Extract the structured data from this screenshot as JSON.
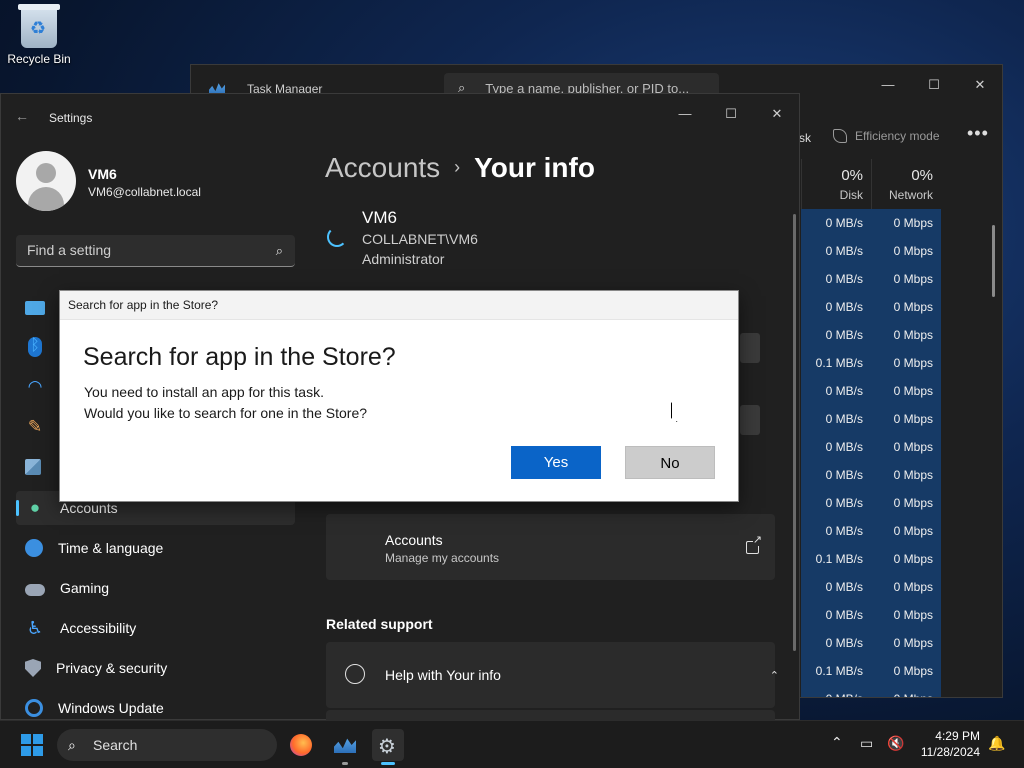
{
  "desktop": {
    "recycle_bin_label": "Recycle Bin"
  },
  "task_manager": {
    "title": "Task Manager",
    "search_placeholder": "Type a name, publisher, or PID to...",
    "toolbar_fragment": "sk",
    "efficiency_mode": "Efficiency mode",
    "more": "•••",
    "columns": [
      {
        "percent": "0%",
        "name": "Disk"
      },
      {
        "percent": "0%",
        "name": "Network"
      }
    ],
    "rows": [
      {
        "disk": "0 MB/s",
        "network": "0 Mbps"
      },
      {
        "disk": "0 MB/s",
        "network": "0 Mbps"
      },
      {
        "disk": "0 MB/s",
        "network": "0 Mbps"
      },
      {
        "disk": "0 MB/s",
        "network": "0 Mbps"
      },
      {
        "disk": "0 MB/s",
        "network": "0 Mbps"
      },
      {
        "disk": "0.1 MB/s",
        "network": "0 Mbps"
      },
      {
        "disk": "0 MB/s",
        "network": "0 Mbps"
      },
      {
        "disk": "0 MB/s",
        "network": "0 Mbps"
      },
      {
        "disk": "0 MB/s",
        "network": "0 Mbps"
      },
      {
        "disk": "0 MB/s",
        "network": "0 Mbps"
      },
      {
        "disk": "0 MB/s",
        "network": "0 Mbps"
      },
      {
        "disk": "0 MB/s",
        "network": "0 Mbps"
      },
      {
        "disk": "0.1 MB/s",
        "network": "0 Mbps"
      },
      {
        "disk": "0 MB/s",
        "network": "0 Mbps"
      },
      {
        "disk": "0 MB/s",
        "network": "0 Mbps"
      },
      {
        "disk": "0 MB/s",
        "network": "0 Mbps"
      },
      {
        "disk": "0.1 MB/s",
        "network": "0 Mbps"
      },
      {
        "disk": "0 MB/s",
        "network": "0 Mbps"
      }
    ]
  },
  "settings": {
    "title": "Settings",
    "user": {
      "name": "VM6",
      "email": "VM6@collabnet.local"
    },
    "find_placeholder": "Find a setting",
    "nav": [
      {
        "label": "",
        "icon": "display-icon"
      },
      {
        "label": "",
        "icon": "bluetooth-icon"
      },
      {
        "label": "",
        "icon": "network-icon"
      },
      {
        "label": "",
        "icon": "personalization-icon"
      },
      {
        "label": "",
        "icon": "apps-icon"
      },
      {
        "label": "Accounts",
        "icon": "accounts-icon"
      },
      {
        "label": "Time & language",
        "icon": "time-language-icon"
      },
      {
        "label": "Gaming",
        "icon": "gaming-icon"
      },
      {
        "label": "Accessibility",
        "icon": "accessibility-icon"
      },
      {
        "label": "Privacy & security",
        "icon": "shield-icon"
      },
      {
        "label": "Windows Update",
        "icon": "update-icon"
      }
    ],
    "breadcrumb": {
      "parent": "Accounts",
      "separator": "›",
      "current": "Your info"
    },
    "info": {
      "name": "VM6",
      "account": "COLLABNET\\VM6",
      "role": "Administrator"
    },
    "accounts_card": {
      "title": "Accounts",
      "subtitle": "Manage my accounts"
    },
    "related_support": "Related support",
    "help_card": {
      "title": "Help with Your info"
    }
  },
  "dialog": {
    "titlebar": "Search for app in the Store?",
    "heading": "Search for app in the Store?",
    "line1": "You need to install an app for this task.",
    "line2": "Would you like to search for one in the Store?",
    "yes": "Yes",
    "no": "No"
  },
  "taskbar": {
    "search_label": "Search",
    "time": "4:29 PM",
    "date": "11/28/2024"
  }
}
